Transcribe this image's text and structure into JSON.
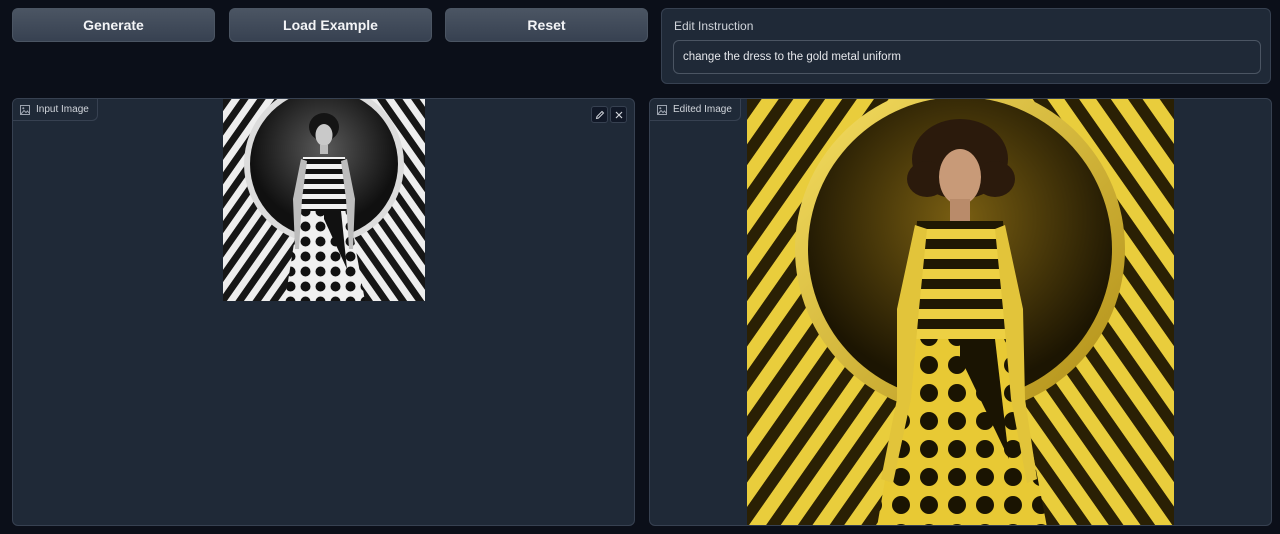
{
  "buttons": {
    "generate": "Generate",
    "load_example": "Load Example",
    "reset": "Reset"
  },
  "instruction": {
    "label": "Edit Instruction",
    "value": "change the dress to the gold metal uniform"
  },
  "input_panel": {
    "label": "Input Image",
    "icons": [
      "image-icon",
      "edit-icon",
      "close-icon"
    ]
  },
  "output_panel": {
    "label": "Edited Image",
    "icons": [
      "image-icon"
    ]
  },
  "colors": {
    "background": "#0b0f19",
    "panel": "#1f2937",
    "border": "#374151",
    "gold": "#e6c72d"
  }
}
